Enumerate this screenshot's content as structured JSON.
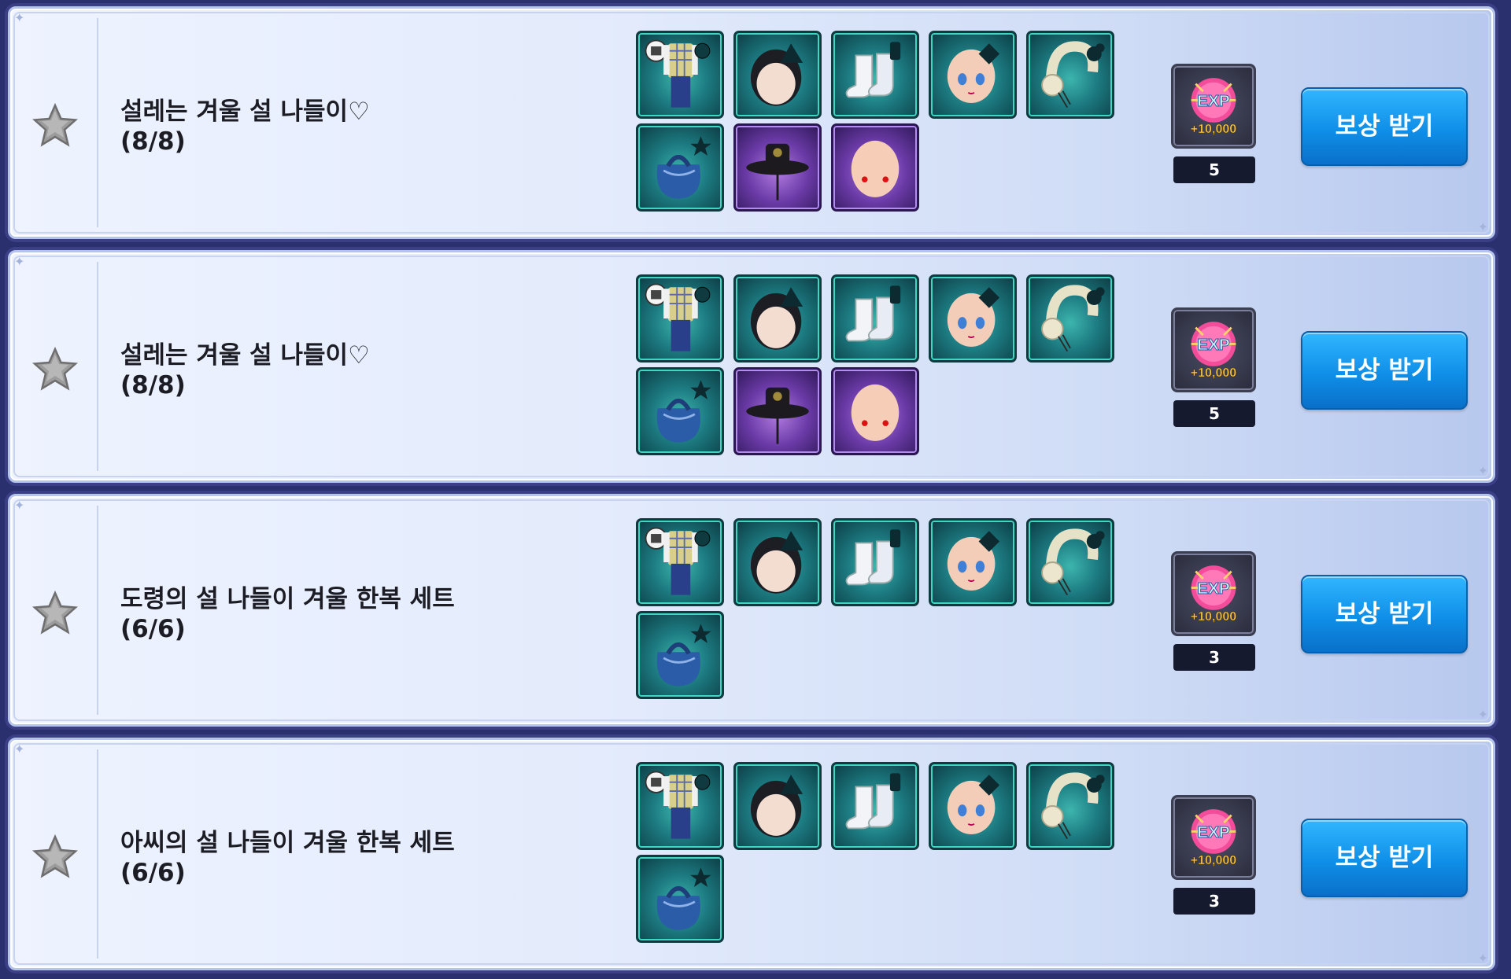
{
  "rows": [
    {
      "title": "설레는 겨울 설 나들이♡",
      "progress": "(8/8)",
      "items_row1": [
        "outfit-icon",
        "hair-icon",
        "shoes-icon",
        "face-icon",
        "earmuff-icon"
      ],
      "items_row2": [
        "bag-icon",
        "gat-hat-icon",
        "blush-face-icon"
      ],
      "exp_label": "EXP",
      "exp_amount": "+10,000",
      "exp_count": "5",
      "button_label": "보상 받기"
    },
    {
      "title": "설레는 겨울 설 나들이♡",
      "progress": "(8/8)",
      "items_row1": [
        "outfit-icon",
        "hair-icon",
        "shoes-icon",
        "face-icon",
        "earmuff-icon"
      ],
      "items_row2": [
        "bag-icon",
        "gat-hat-icon",
        "blush-face-icon"
      ],
      "exp_label": "EXP",
      "exp_amount": "+10,000",
      "exp_count": "5",
      "button_label": "보상 받기"
    },
    {
      "title": "도령의 설 나들이 겨울 한복 세트",
      "progress": "(6/6)",
      "items_row1": [
        "outfit-icon",
        "hair-icon",
        "shoes-icon",
        "face-icon",
        "earmuff-icon"
      ],
      "items_row2": [
        "bag-icon"
      ],
      "exp_label": "EXP",
      "exp_amount": "+10,000",
      "exp_count": "3",
      "button_label": "보상 받기"
    },
    {
      "title": "아씨의 설 나들이 겨울 한복 세트",
      "progress": "(6/6)",
      "items_row1": [
        "outfit-icon",
        "hair-icon",
        "shoes-icon",
        "face-icon",
        "earmuff-icon"
      ],
      "items_row2": [
        "bag-icon"
      ],
      "exp_label": "EXP",
      "exp_amount": "+10,000",
      "exp_count": "3",
      "button_label": "보상 받기"
    }
  ]
}
